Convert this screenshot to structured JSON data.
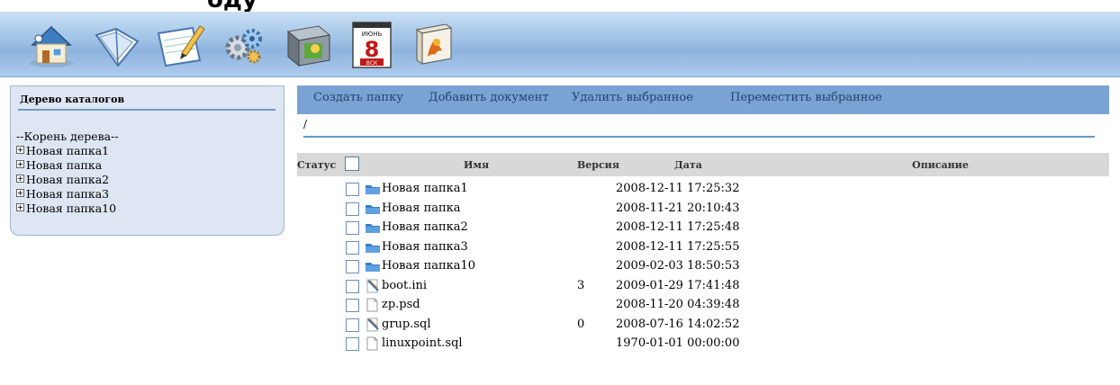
{
  "header_partial_text": "оду",
  "toolbar": {
    "icons": [
      "home-icon",
      "folder-icon",
      "notepad-icon",
      "settings-icon",
      "box-icon",
      "calendar-icon",
      "book-icon"
    ],
    "calendar_month": "ИЮНЬ",
    "calendar_day": "8",
    "calendar_weekday": "ВСК"
  },
  "tree": {
    "title": "Дерево каталогов",
    "root": "--Корень дерева--",
    "items": [
      "Новая папка1",
      "Новая папка",
      "Новая папка2",
      "Новая папка3",
      "Новая папка10"
    ]
  },
  "actions": [
    "Создать папку",
    "Добавить документ",
    "Удалить выбранное",
    "Переместить выбранное"
  ],
  "path": "/",
  "table": {
    "headers": {
      "status": "Статус",
      "name": "Имя",
      "version": "Версия",
      "date": "Дата",
      "description": "Описание"
    },
    "rows": [
      {
        "type": "folder",
        "name": "Новая папка1",
        "version": "",
        "date": "2008-12-11 17:25:32",
        "description": ""
      },
      {
        "type": "folder",
        "name": "Новая папка",
        "version": "",
        "date": "2008-11-21 20:10:43",
        "description": ""
      },
      {
        "type": "folder",
        "name": "Новая папка2",
        "version": "",
        "date": "2008-12-11 17:25:48",
        "description": ""
      },
      {
        "type": "folder",
        "name": "Новая папка3",
        "version": "",
        "date": "2008-12-11 17:25:55",
        "description": ""
      },
      {
        "type": "folder",
        "name": "Новая папка10",
        "version": "",
        "date": "2009-02-03 18:50:53",
        "description": ""
      },
      {
        "type": "text-file",
        "name": "boot.ini",
        "version": "3",
        "date": "2009-01-29 17:41:48",
        "description": ""
      },
      {
        "type": "file",
        "name": "zp.psd",
        "version": "",
        "date": "2008-11-20 04:39:48",
        "description": ""
      },
      {
        "type": "text-file",
        "name": "grup.sql",
        "version": "0",
        "date": "2008-07-16 14:02:52",
        "description": ""
      },
      {
        "type": "file",
        "name": "linuxpoint.sql",
        "version": "",
        "date": "1970-01-01 00:00:00",
        "description": ""
      }
    ]
  }
}
